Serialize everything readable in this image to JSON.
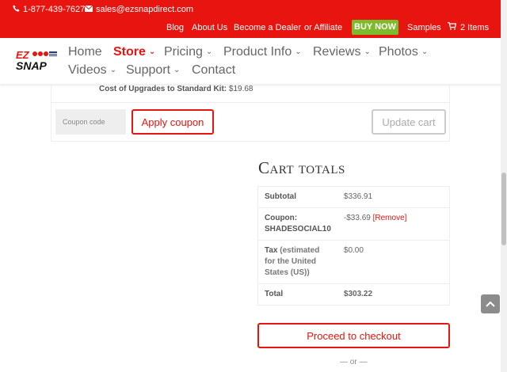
{
  "topbar": {
    "phone": "1-877-439-7627",
    "email": "sales@ezsnapdirect.com",
    "links": [
      "Blog",
      "About Us",
      "Become a Dealer",
      "or Affiliate"
    ],
    "buy_now": "BUY NOW",
    "samples": "Samples",
    "cart_count": "2 Items",
    "bg_color": "#e8140f",
    "buy_color": "#7cbb2a"
  },
  "logo": {
    "text_top": "EZ",
    "text_bottom": "SNAP"
  },
  "nav": {
    "home": "Home",
    "store": "Store",
    "pricing": "Pricing",
    "product_info": "Product Info",
    "reviews": "Reviews",
    "photos": "Photos",
    "videos": "Videos",
    "support": "Support",
    "contact": "Contact"
  },
  "cart": {
    "upgrades_label": "Cost of Upgrades to Standard Kit:",
    "upgrades_value": "$19.68",
    "coupon_placeholder": "Coupon code",
    "apply_coupon": "Apply coupon",
    "update_cart": "Update cart"
  },
  "totals": {
    "title": "Cart totals",
    "subtotal_label": "Subtotal",
    "subtotal_value": "$336.91",
    "coupon_label": "Coupon: SHADESOCIAL10",
    "coupon_value": "-$33.69",
    "remove_label": "[Remove]",
    "tax_label": "Tax",
    "tax_note": "(estimated for the United States (US))",
    "tax_value": "$0.00",
    "total_label": "Total",
    "total_value": "$303.22",
    "checkout": "Proceed to checkout",
    "or": "— or —"
  },
  "icons": {
    "phone": "phone-icon",
    "email": "envelope-icon",
    "cart": "shopping-cart-icon",
    "scroll_top": "chevron-up-icon"
  }
}
